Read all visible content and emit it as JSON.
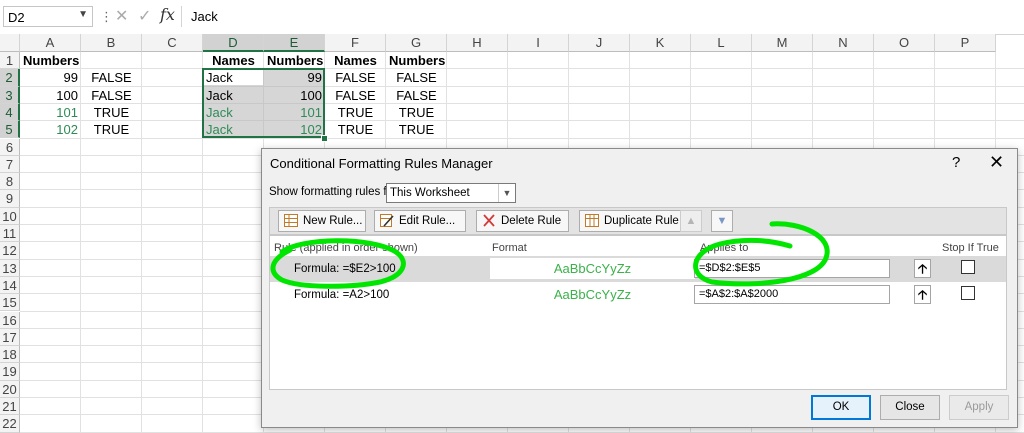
{
  "formula_bar": {
    "name_box": "D2",
    "fx_label": "fx",
    "content": "Jack"
  },
  "columns": [
    "A",
    "B",
    "C",
    "D",
    "E",
    "F",
    "G",
    "H",
    "I",
    "J",
    "K",
    "L",
    "M",
    "N",
    "O",
    "P"
  ],
  "rows": [
    "1",
    "2",
    "3",
    "4",
    "5",
    "6",
    "7",
    "8",
    "9",
    "10",
    "11",
    "12",
    "13",
    "14",
    "15",
    "16",
    "17",
    "18",
    "19",
    "20",
    "21",
    "22"
  ],
  "cells": {
    "A1": "Numbers",
    "A2": "99",
    "B2": "FALSE",
    "A3": "100",
    "B3": "FALSE",
    "A4": "101",
    "B4": "TRUE",
    "A5": "102",
    "B5": "TRUE",
    "D1": "Names",
    "E1": "Numbers",
    "F1": "Names",
    "G1": "Numbers",
    "D2": "Jack",
    "E2": "99",
    "F2": "FALSE",
    "G2": "FALSE",
    "D3": "Jack",
    "E3": "100",
    "F3": "FALSE",
    "G3": "FALSE",
    "D4": "Jack",
    "E4": "101",
    "F4": "TRUE",
    "G4": "TRUE",
    "D5": "Jack",
    "E5": "102",
    "F5": "TRUE",
    "G5": "TRUE"
  },
  "colors": {
    "excel_green": "#217346",
    "format_green": "#3bb14a",
    "annotation_green": "#00e600",
    "ok_blue": "#0078d7"
  },
  "dialog": {
    "title": "Conditional Formatting Rules Manager",
    "help": "?",
    "close": "✕",
    "show_label": "Show formatting rules for:",
    "show_value": "This Worksheet",
    "toolbar": {
      "new_rule": "New Rule...",
      "edit_rule": "Edit Rule...",
      "delete_rule": "Delete Rule",
      "duplicate_rule": "Duplicate Rule",
      "move_up": "▲",
      "move_down": "▼"
    },
    "headers": {
      "rule": "Rule (applied in order shown)",
      "format": "Format",
      "applies_to": "Applies to",
      "stop_if_true": "Stop If True"
    },
    "rules": [
      {
        "rule": "Formula: =$E2>100",
        "format_preview": "AaBbCcYyZz",
        "applies_to": "=$D$2:$E$5",
        "stop_if_true": false
      },
      {
        "rule": "Formula: =A2>100",
        "format_preview": "AaBbCcYyZz",
        "applies_to": "=$A$2:$A$2000",
        "stop_if_true": false
      }
    ],
    "buttons": {
      "ok": "OK",
      "close": "Close",
      "apply": "Apply"
    }
  }
}
